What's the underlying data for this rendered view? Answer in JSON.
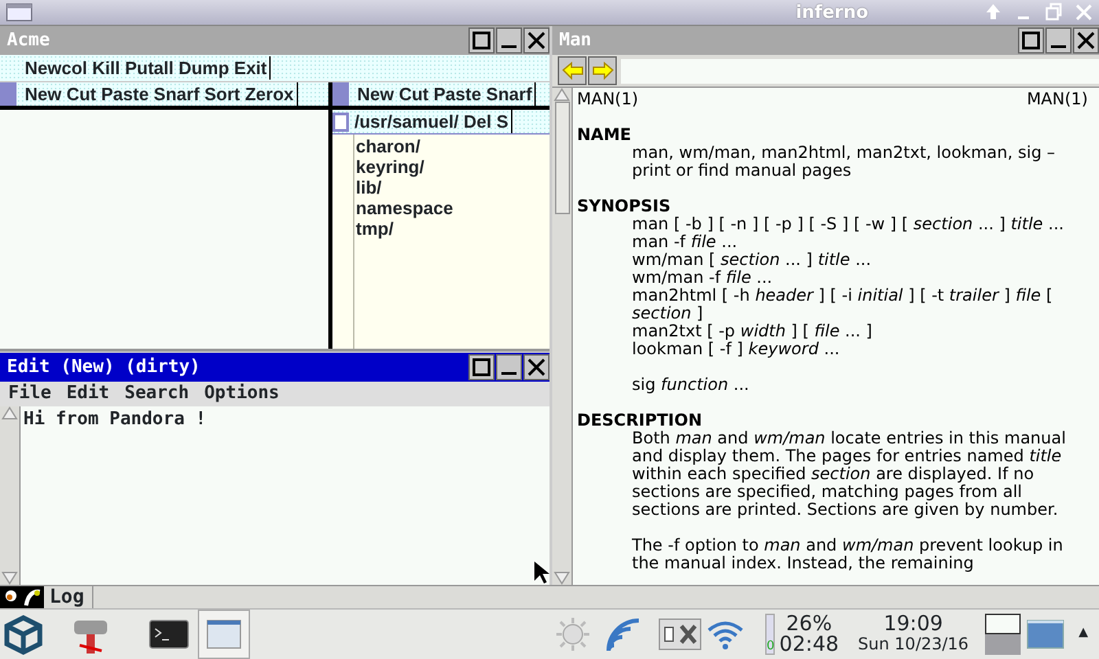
{
  "title_bar": {
    "title": "inferno"
  },
  "acme": {
    "title": "Acme",
    "active": false,
    "tag": "Newcol Kill Putall Dump Exit",
    "columns": [
      {
        "tag": "New Cut Paste Snarf Sort Zerox"
      },
      {
        "tag": "New Cut Paste Snarf",
        "windows": [
          {
            "tag": "/usr/samuel/ Del S",
            "lines": [
              "charon/",
              "keyring/",
              "lib/",
              "namespace",
              "tmp/"
            ]
          }
        ]
      }
    ]
  },
  "editor": {
    "title": "Edit (New) (dirty)",
    "active": true,
    "menu": [
      "File",
      "Edit",
      "Search",
      "Options"
    ],
    "text": "Hi from Pandora !"
  },
  "man": {
    "title": "Man",
    "active": false,
    "header_left": "MAN(1)",
    "header_right": "MAN(1)",
    "sections": [
      {
        "heading": "NAME",
        "blocks": [
          [
            "man, wm/man, man2html, man2txt, lookman, sig – print or find manual pages"
          ]
        ]
      },
      {
        "heading": "SYNOPSIS",
        "blocks": [
          [
            "man [ -b ] [ -n ] [ -p ] [ -S ] [ -w ] [ *section* ... ] *title* ...",
            "man -f *file* ...",
            "wm/man [ *section* ... ] *title* ...",
            "wm/man -f *file* ...",
            "man2html [ -h *header* ] [ -i *initial* ] [ -t *trailer* ] *file* [ *section* ]",
            "man2txt [ -p *width* ] [ *file* ... ]",
            "lookman [ -f ] *keyword* ..."
          ],
          [
            "sig *function* ..."
          ]
        ]
      },
      {
        "heading": "DESCRIPTION",
        "blocks": [
          [
            "Both *man* and *wm/man* locate entries in this manual and display them. The pages for entries named *title* within each specified *section* are displayed. If no sections are specified, matching pages from all sections are printed. Sections are given by number."
          ],
          [
            "The -f option to *man* and *wm/man* prevent lookup in the manual index. Instead, the remaining"
          ]
        ]
      }
    ]
  },
  "log_bar": {
    "label": "Log"
  },
  "taskbar": {
    "battery": {
      "percent": "26%",
      "time": "02:48",
      "gauge_label": "0"
    },
    "clock": {
      "time": "19:09",
      "date": "Sun 10/23/16"
    },
    "workspaces": [
      {
        "selected": true
      },
      {
        "selected": false
      }
    ],
    "tray_arrow": "▲"
  }
}
